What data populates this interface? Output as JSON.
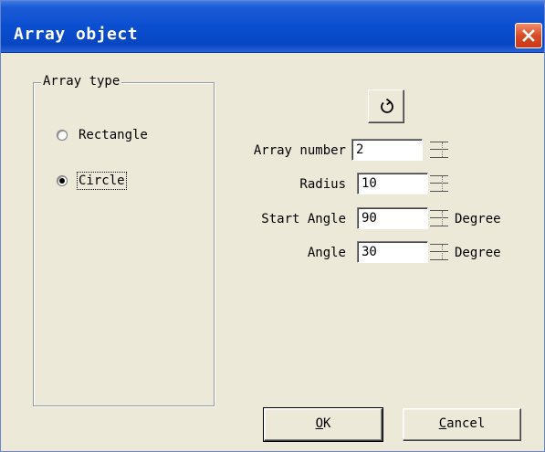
{
  "window": {
    "title": "Array object"
  },
  "array_type": {
    "legend": "Array type",
    "options": [
      {
        "label": "Rectangle",
        "checked": false
      },
      {
        "label": "Circle",
        "checked": true
      }
    ]
  },
  "toolbar": {
    "rotate_icon": "rotate-icon"
  },
  "fields": {
    "array_number": {
      "label": "Array number",
      "value": "2"
    },
    "radius": {
      "label": "Radius",
      "value": "10"
    },
    "start_angle": {
      "label": "Start Angle",
      "value": "90",
      "unit": "Degree"
    },
    "angle": {
      "label": "Angle",
      "value": "30",
      "unit": "Degree"
    }
  },
  "buttons": {
    "ok_mnemonic": "O",
    "ok_rest": "K",
    "cancel_mnemonic": "C",
    "cancel_rest": "ancel"
  }
}
